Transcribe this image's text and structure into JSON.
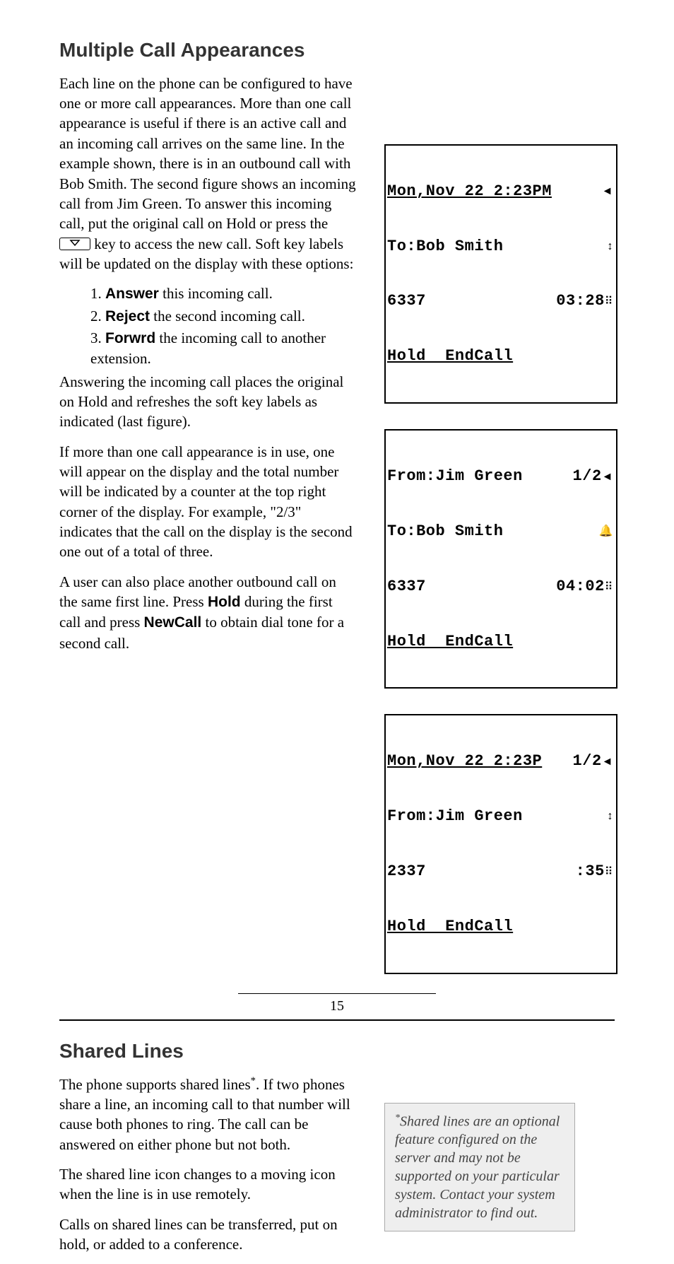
{
  "section1": {
    "heading": "Multiple Call Appearances",
    "p1a": "Each line on the phone can be configured to have one or more call appearances.  More than one call appearance is useful if there is an active call and an incoming call arrives on the same line.  In the example shown, there is in an outbound call with Bob Smith.  The second figure shows an incoming call from Jim Green.  To answer this incoming call, put the original call on Hold or press the ",
    "p1b": " key to access the new call.  Soft key labels will be updated on the display with these options:",
    "li1_num": "1.  ",
    "li1_bold": "Answer",
    "li1_rest": " this incoming call.",
    "li2_num": "2.  ",
    "li2_bold": "Reject",
    "li2_rest": " the second incoming call.",
    "li3_num": "3.  ",
    "li3_bold": "Forwrd",
    "li3_rest": " the incoming call to another extension.",
    "p2": "Answering the incoming call places the original on Hold and refreshes the soft key labels as indicated (last figure).",
    "p3": "If more than one call appearance is in use, one will appear on the display and the total number will be indicated by a counter at the top right corner of the display.  For example, \"2/3\" indicates that the call on the display is the second one out of a total of three.",
    "p4a": "A user can also place another outbound call on the same first line.  Press ",
    "p4_hold": "Hold",
    "p4b": " during the first call and press ",
    "p4_newcall": "NewCall",
    "p4c": " to obtain dial tone for a second call."
  },
  "section2": {
    "heading": "Shared Lines",
    "p1": "The phone supports shared lines",
    "p1b": ".  If two phones share a line, an incoming call to that number will cause both phones to ring.  The call can be answered on either phone but not both.",
    "p2": "The shared line icon changes to a moving icon when the line is in use remotely.",
    "p3": "Calls on shared lines can be transferred, put on hold, or added to a conference.",
    "note": "Shared lines are an optional feature configured on the server and may not be supported on your particular system.  Contact your system administrator to find out."
  },
  "lcd1": {
    "l1": "Mon,Nov 22 2:23PM",
    "l2": "To:Bob Smith",
    "l3a": "6337",
    "l3b": "03:28",
    "l4": "Hold  EndCall"
  },
  "lcd2": {
    "l1a": "From:Jim Green",
    "l1b": "1/2",
    "l2": "To:Bob Smith",
    "l3a": "6337",
    "l3b": "04:02",
    "l4": "Hold  EndCall"
  },
  "lcd3": {
    "l1a": "Mon,Nov 22 2:23P",
    "l1b": "1/2",
    "l2": "From:Jim Green",
    "l3a": "2337",
    "l3b": ":35",
    "l4": "Hold  EndCall"
  },
  "pagenum": "15",
  "star": "*"
}
